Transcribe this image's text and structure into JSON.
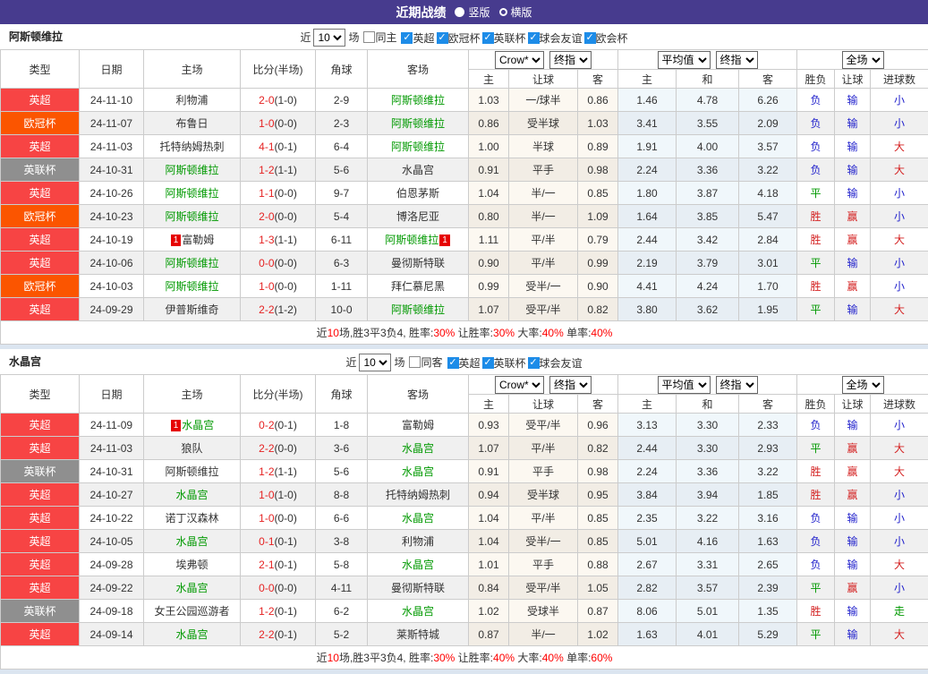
{
  "titlebar": {
    "title": "近期战绩",
    "radio_options": [
      {
        "label": "竖版",
        "selected": true
      },
      {
        "label": "横版",
        "selected": false
      }
    ]
  },
  "labels": {
    "near": "近",
    "games": "场"
  },
  "columns": {
    "type": "类型",
    "date": "日期",
    "home": "主场",
    "score": "比分(半场)",
    "corner": "角球",
    "away": "客场",
    "odds_home": "主",
    "odds_handicap": "让球",
    "odds_away": "客",
    "avg_home": "主",
    "avg_draw": "和",
    "avg_away": "客",
    "result": "胜负",
    "handicap_result": "让球",
    "goals": "进球数"
  },
  "dropdowns": {
    "bookmaker": "Crow*",
    "final1": "终指",
    "average": "平均值",
    "final2": "终指",
    "scope": "全场"
  },
  "colors": {
    "header_purple": "#473b8e",
    "league_red": "#f74444",
    "league_orange": "#fb5500",
    "league_gray": "#8f8f8f",
    "team_green": "#009900",
    "score_red": "#e52222",
    "win_red": "#d42222",
    "draw_green": "#009900",
    "lose_blue": "#2222cc",
    "checkbox_blue": "#1d8ce8",
    "odds_bg": "#fcf8f1",
    "avg_bg": "#f0f7fb"
  },
  "sections": [
    {
      "team": "阿斯顿维拉",
      "filter": {
        "rounds": "10",
        "same_label": "同主",
        "same_checked": false,
        "competitions": [
          {
            "label": "英超",
            "checked": true
          },
          {
            "label": "欧冠杯",
            "checked": true
          },
          {
            "label": "英联杯",
            "checked": true
          },
          {
            "label": "球会友谊",
            "checked": true
          },
          {
            "label": "欧会杯",
            "checked": true
          }
        ]
      },
      "rows": [
        {
          "league": "英超",
          "league_color": "red",
          "date": "24-11-10",
          "home": "利物浦",
          "home_green": false,
          "home_card": "",
          "score": "2-0",
          "half": "(1-0)",
          "corner": "2-9",
          "away": "阿斯顿维拉",
          "away_green": true,
          "away_card": "",
          "odds": [
            "1.03",
            "一/球半",
            "0.86"
          ],
          "avg": [
            "1.46",
            "4.78",
            "6.26"
          ],
          "verdicts": [
            [
              "负",
              "blue"
            ],
            [
              "输",
              "blue"
            ],
            [
              "小",
              "blue"
            ]
          ]
        },
        {
          "league": "欧冠杯",
          "league_color": "orange",
          "date": "24-11-07",
          "home": "布鲁日",
          "home_green": false,
          "home_card": "",
          "score": "1-0",
          "half": "(0-0)",
          "corner": "2-3",
          "away": "阿斯顿维拉",
          "away_green": true,
          "away_card": "",
          "odds": [
            "0.86",
            "受半球",
            "1.03"
          ],
          "avg": [
            "3.41",
            "3.55",
            "2.09"
          ],
          "verdicts": [
            [
              "负",
              "blue"
            ],
            [
              "输",
              "blue"
            ],
            [
              "小",
              "blue"
            ]
          ]
        },
        {
          "league": "英超",
          "league_color": "red",
          "date": "24-11-03",
          "home": "托特纳姆热刺",
          "home_green": false,
          "home_card": "",
          "score": "4-1",
          "half": "(0-1)",
          "corner": "6-4",
          "away": "阿斯顿维拉",
          "away_green": true,
          "away_card": "",
          "odds": [
            "1.00",
            "半球",
            "0.89"
          ],
          "avg": [
            "1.91",
            "4.00",
            "3.57"
          ],
          "verdicts": [
            [
              "负",
              "blue"
            ],
            [
              "输",
              "blue"
            ],
            [
              "大",
              "red"
            ]
          ]
        },
        {
          "league": "英联杯",
          "league_color": "gray",
          "date": "24-10-31",
          "home": "阿斯顿维拉",
          "home_green": true,
          "home_card": "",
          "score": "1-2",
          "half": "(1-1)",
          "corner": "5-6",
          "away": "水晶宫",
          "away_green": false,
          "away_card": "",
          "odds": [
            "0.91",
            "平手",
            "0.98"
          ],
          "avg": [
            "2.24",
            "3.36",
            "3.22"
          ],
          "verdicts": [
            [
              "负",
              "blue"
            ],
            [
              "输",
              "blue"
            ],
            [
              "大",
              "red"
            ]
          ]
        },
        {
          "league": "英超",
          "league_color": "red",
          "date": "24-10-26",
          "home": "阿斯顿维拉",
          "home_green": true,
          "home_card": "",
          "score": "1-1",
          "half": "(0-0)",
          "corner": "9-7",
          "away": "伯恩茅斯",
          "away_green": false,
          "away_card": "",
          "odds": [
            "1.04",
            "半/一",
            "0.85"
          ],
          "avg": [
            "1.80",
            "3.87",
            "4.18"
          ],
          "verdicts": [
            [
              "平",
              "green"
            ],
            [
              "输",
              "blue"
            ],
            [
              "小",
              "blue"
            ]
          ]
        },
        {
          "league": "欧冠杯",
          "league_color": "orange",
          "date": "24-10-23",
          "home": "阿斯顿维拉",
          "home_green": true,
          "home_card": "",
          "score": "2-0",
          "half": "(0-0)",
          "corner": "5-4",
          "away": "博洛尼亚",
          "away_green": false,
          "away_card": "",
          "odds": [
            "0.80",
            "半/一",
            "1.09"
          ],
          "avg": [
            "1.64",
            "3.85",
            "5.47"
          ],
          "verdicts": [
            [
              "胜",
              "red"
            ],
            [
              "赢",
              "red"
            ],
            [
              "小",
              "blue"
            ]
          ]
        },
        {
          "league": "英超",
          "league_color": "red",
          "date": "24-10-19",
          "home": "富勒姆",
          "home_green": false,
          "home_card": "1",
          "score": "1-3",
          "half": "(1-1)",
          "corner": "6-11",
          "away": "阿斯顿维拉",
          "away_green": true,
          "away_card": "1",
          "odds": [
            "1.11",
            "平/半",
            "0.79"
          ],
          "avg": [
            "2.44",
            "3.42",
            "2.84"
          ],
          "verdicts": [
            [
              "胜",
              "red"
            ],
            [
              "赢",
              "red"
            ],
            [
              "大",
              "red"
            ]
          ]
        },
        {
          "league": "英超",
          "league_color": "red",
          "date": "24-10-06",
          "home": "阿斯顿维拉",
          "home_green": true,
          "home_card": "",
          "score": "0-0",
          "half": "(0-0)",
          "corner": "6-3",
          "away": "曼彻斯特联",
          "away_green": false,
          "away_card": "",
          "odds": [
            "0.90",
            "平/半",
            "0.99"
          ],
          "avg": [
            "2.19",
            "3.79",
            "3.01"
          ],
          "verdicts": [
            [
              "平",
              "green"
            ],
            [
              "输",
              "blue"
            ],
            [
              "小",
              "blue"
            ]
          ]
        },
        {
          "league": "欧冠杯",
          "league_color": "orange",
          "date": "24-10-03",
          "home": "阿斯顿维拉",
          "home_green": true,
          "home_card": "",
          "score": "1-0",
          "half": "(0-0)",
          "corner": "1-11",
          "away": "拜仁慕尼黑",
          "away_green": false,
          "away_card": "",
          "odds": [
            "0.99",
            "受半/一",
            "0.90"
          ],
          "avg": [
            "4.41",
            "4.24",
            "1.70"
          ],
          "verdicts": [
            [
              "胜",
              "red"
            ],
            [
              "赢",
              "red"
            ],
            [
              "小",
              "blue"
            ]
          ]
        },
        {
          "league": "英超",
          "league_color": "red",
          "date": "24-09-29",
          "home": "伊普斯维奇",
          "home_green": false,
          "home_card": "",
          "score": "2-2",
          "half": "(1-2)",
          "corner": "10-0",
          "away": "阿斯顿维拉",
          "away_green": true,
          "away_card": "",
          "odds": [
            "1.07",
            "受平/半",
            "0.82"
          ],
          "avg": [
            "3.80",
            "3.62",
            "1.95"
          ],
          "verdicts": [
            [
              "平",
              "green"
            ],
            [
              "输",
              "blue"
            ],
            [
              "大",
              "red"
            ]
          ]
        }
      ],
      "summary": [
        [
          "近",
          "dark"
        ],
        [
          "10",
          "red"
        ],
        [
          "场,胜3平3负4, 胜率:",
          "dark"
        ],
        [
          "30%",
          "red"
        ],
        [
          " 让胜率:",
          "dark"
        ],
        [
          "30%",
          "red"
        ],
        [
          " 大率:",
          "dark"
        ],
        [
          "40%",
          "red"
        ],
        [
          " 单率:",
          "dark"
        ],
        [
          "40%",
          "red"
        ]
      ]
    },
    {
      "team": "水晶宫",
      "filter": {
        "rounds": "10",
        "same_label": "同客",
        "same_checked": false,
        "competitions": [
          {
            "label": "英超",
            "checked": true
          },
          {
            "label": "英联杯",
            "checked": true
          },
          {
            "label": "球会友谊",
            "checked": true
          }
        ]
      },
      "rows": [
        {
          "league": "英超",
          "league_color": "red",
          "date": "24-11-09",
          "home": "水晶宫",
          "home_green": true,
          "home_card": "1",
          "score": "0-2",
          "half": "(0-1)",
          "corner": "1-8",
          "away": "富勒姆",
          "away_green": false,
          "away_card": "",
          "odds": [
            "0.93",
            "受平/半",
            "0.96"
          ],
          "avg": [
            "3.13",
            "3.30",
            "2.33"
          ],
          "verdicts": [
            [
              "负",
              "blue"
            ],
            [
              "输",
              "blue"
            ],
            [
              "小",
              "blue"
            ]
          ]
        },
        {
          "league": "英超",
          "league_color": "red",
          "date": "24-11-03",
          "home": "狼队",
          "home_green": false,
          "home_card": "",
          "score": "2-2",
          "half": "(0-0)",
          "corner": "3-6",
          "away": "水晶宫",
          "away_green": true,
          "away_card": "",
          "odds": [
            "1.07",
            "平/半",
            "0.82"
          ],
          "avg": [
            "2.44",
            "3.30",
            "2.93"
          ],
          "verdicts": [
            [
              "平",
              "green"
            ],
            [
              "赢",
              "red"
            ],
            [
              "大",
              "red"
            ]
          ]
        },
        {
          "league": "英联杯",
          "league_color": "gray",
          "date": "24-10-31",
          "home": "阿斯顿维拉",
          "home_green": false,
          "home_card": "",
          "score": "1-2",
          "half": "(1-1)",
          "corner": "5-6",
          "away": "水晶宫",
          "away_green": true,
          "away_card": "",
          "odds": [
            "0.91",
            "平手",
            "0.98"
          ],
          "avg": [
            "2.24",
            "3.36",
            "3.22"
          ],
          "verdicts": [
            [
              "胜",
              "red"
            ],
            [
              "赢",
              "red"
            ],
            [
              "大",
              "red"
            ]
          ]
        },
        {
          "league": "英超",
          "league_color": "red",
          "date": "24-10-27",
          "home": "水晶宫",
          "home_green": true,
          "home_card": "",
          "score": "1-0",
          "half": "(1-0)",
          "corner": "8-8",
          "away": "托特纳姆热刺",
          "away_green": false,
          "away_card": "",
          "odds": [
            "0.94",
            "受半球",
            "0.95"
          ],
          "avg": [
            "3.84",
            "3.94",
            "1.85"
          ],
          "verdicts": [
            [
              "胜",
              "red"
            ],
            [
              "赢",
              "red"
            ],
            [
              "小",
              "blue"
            ]
          ]
        },
        {
          "league": "英超",
          "league_color": "red",
          "date": "24-10-22",
          "home": "诺丁汉森林",
          "home_green": false,
          "home_card": "",
          "score": "1-0",
          "half": "(0-0)",
          "corner": "6-6",
          "away": "水晶宫",
          "away_green": true,
          "away_card": "",
          "odds": [
            "1.04",
            "平/半",
            "0.85"
          ],
          "avg": [
            "2.35",
            "3.22",
            "3.16"
          ],
          "verdicts": [
            [
              "负",
              "blue"
            ],
            [
              "输",
              "blue"
            ],
            [
              "小",
              "blue"
            ]
          ]
        },
        {
          "league": "英超",
          "league_color": "red",
          "date": "24-10-05",
          "home": "水晶宫",
          "home_green": true,
          "home_card": "",
          "score": "0-1",
          "half": "(0-1)",
          "corner": "3-8",
          "away": "利物浦",
          "away_green": false,
          "away_card": "",
          "odds": [
            "1.04",
            "受半/一",
            "0.85"
          ],
          "avg": [
            "5.01",
            "4.16",
            "1.63"
          ],
          "verdicts": [
            [
              "负",
              "blue"
            ],
            [
              "输",
              "blue"
            ],
            [
              "小",
              "blue"
            ]
          ]
        },
        {
          "league": "英超",
          "league_color": "red",
          "date": "24-09-28",
          "home": "埃弗顿",
          "home_green": false,
          "home_card": "",
          "score": "2-1",
          "half": "(0-1)",
          "corner": "5-8",
          "away": "水晶宫",
          "away_green": true,
          "away_card": "",
          "odds": [
            "1.01",
            "平手",
            "0.88"
          ],
          "avg": [
            "2.67",
            "3.31",
            "2.65"
          ],
          "verdicts": [
            [
              "负",
              "blue"
            ],
            [
              "输",
              "blue"
            ],
            [
              "大",
              "red"
            ]
          ]
        },
        {
          "league": "英超",
          "league_color": "red",
          "date": "24-09-22",
          "home": "水晶宫",
          "home_green": true,
          "home_card": "",
          "score": "0-0",
          "half": "(0-0)",
          "corner": "4-11",
          "away": "曼彻斯特联",
          "away_green": false,
          "away_card": "",
          "odds": [
            "0.84",
            "受平/半",
            "1.05"
          ],
          "avg": [
            "2.82",
            "3.57",
            "2.39"
          ],
          "verdicts": [
            [
              "平",
              "green"
            ],
            [
              "赢",
              "red"
            ],
            [
              "小",
              "blue"
            ]
          ]
        },
        {
          "league": "英联杯",
          "league_color": "gray",
          "date": "24-09-18",
          "home": "女王公园巡游者",
          "home_green": false,
          "home_card": "",
          "score": "1-2",
          "half": "(0-1)",
          "corner": "6-2",
          "away": "水晶宫",
          "away_green": true,
          "away_card": "",
          "odds": [
            "1.02",
            "受球半",
            "0.87"
          ],
          "avg": [
            "8.06",
            "5.01",
            "1.35"
          ],
          "verdicts": [
            [
              "胜",
              "red"
            ],
            [
              "输",
              "blue"
            ],
            [
              "走",
              "green"
            ]
          ]
        },
        {
          "league": "英超",
          "league_color": "red",
          "date": "24-09-14",
          "home": "水晶宫",
          "home_green": true,
          "home_card": "",
          "score": "2-2",
          "half": "(0-1)",
          "corner": "5-2",
          "away": "莱斯特城",
          "away_green": false,
          "away_card": "",
          "odds": [
            "0.87",
            "半/一",
            "1.02"
          ],
          "avg": [
            "1.63",
            "4.01",
            "5.29"
          ],
          "verdicts": [
            [
              "平",
              "green"
            ],
            [
              "输",
              "blue"
            ],
            [
              "大",
              "red"
            ]
          ]
        }
      ],
      "summary": [
        [
          "近",
          "dark"
        ],
        [
          "10",
          "red"
        ],
        [
          "场,胜3平3负4, 胜率:",
          "dark"
        ],
        [
          "30%",
          "red"
        ],
        [
          " 让胜率:",
          "dark"
        ],
        [
          "40%",
          "red"
        ],
        [
          " 大率:",
          "dark"
        ],
        [
          "40%",
          "red"
        ],
        [
          " 单率:",
          "dark"
        ],
        [
          "60%",
          "red"
        ]
      ]
    }
  ]
}
